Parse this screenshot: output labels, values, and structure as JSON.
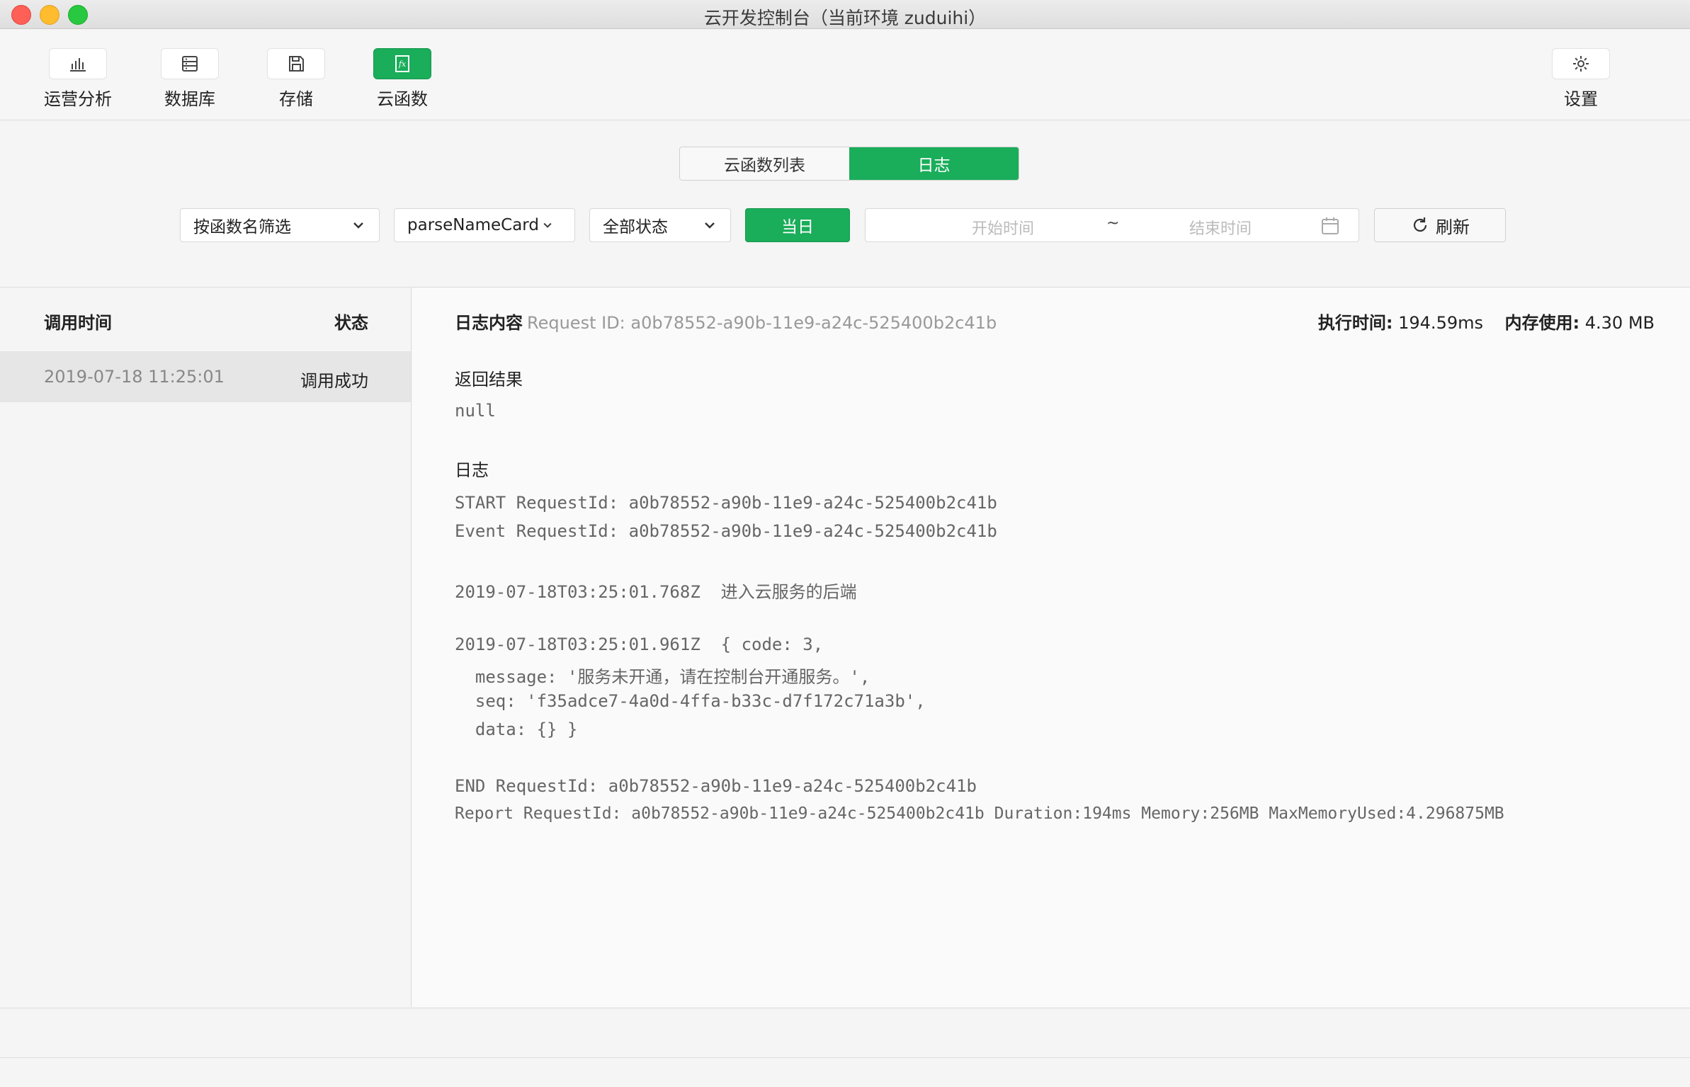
{
  "window": {
    "title": "云开发控制台（当前环境 zuduihi）"
  },
  "toolbar": {
    "items": [
      {
        "label": "运营分析",
        "icon": "bar-chart-icon"
      },
      {
        "label": "数据库",
        "icon": "database-icon"
      },
      {
        "label": "存储",
        "icon": "save-disk-icon"
      },
      {
        "label": "云函数",
        "icon": "function-fx-icon",
        "active": true
      }
    ],
    "settings_label": "设置"
  },
  "tabs": {
    "function_list": "云函数列表",
    "logs": "日志",
    "active": "日志"
  },
  "filters": {
    "filter_by": "按函数名筛选",
    "function_name": "parseNameCard",
    "status": "全部状态",
    "today_button": "当日",
    "start_placeholder": "开始时间",
    "separator": "~",
    "end_placeholder": "结束时间",
    "refresh_label": "刷新"
  },
  "invocations": {
    "col_time": "调用时间",
    "col_status": "状态",
    "rows": [
      {
        "time": "2019-07-18 11:25:01",
        "status": "调用成功"
      }
    ]
  },
  "log": {
    "title": "日志内容",
    "request_id": "Request ID: a0b78552-a90b-11e9-a24c-525400b2c41b",
    "exec_label": "执行时间:",
    "exec_value": "194.59ms",
    "mem_label": "内存使用:",
    "mem_value": "4.30 MB",
    "result_title": "返回结果",
    "result_value": "null",
    "logs_title": "日志",
    "lines": [
      "START RequestId: a0b78552-a90b-11e9-a24c-525400b2c41b",
      "Event RequestId: a0b78552-a90b-11e9-a24c-525400b2c41b",
      "2019-07-18T03:25:01.768Z  进入云服务的后端",
      "2019-07-18T03:25:01.961Z  { code: 3,",
      "  message: '服务未开通，请在控制台开通服务。',",
      "  seq: 'f35adce7-4a0d-4ffa-b33c-d7f172c71a3b',",
      "  data: {} }",
      "END RequestId: a0b78552-a90b-11e9-a24c-525400b2c41b",
      "Report RequestId: a0b78552-a90b-11e9-a24c-525400b2c41b Duration:194ms Memory:256MB MaxMemoryUsed:4.296875MB"
    ]
  },
  "colors": {
    "accent": "#1aad5a"
  }
}
